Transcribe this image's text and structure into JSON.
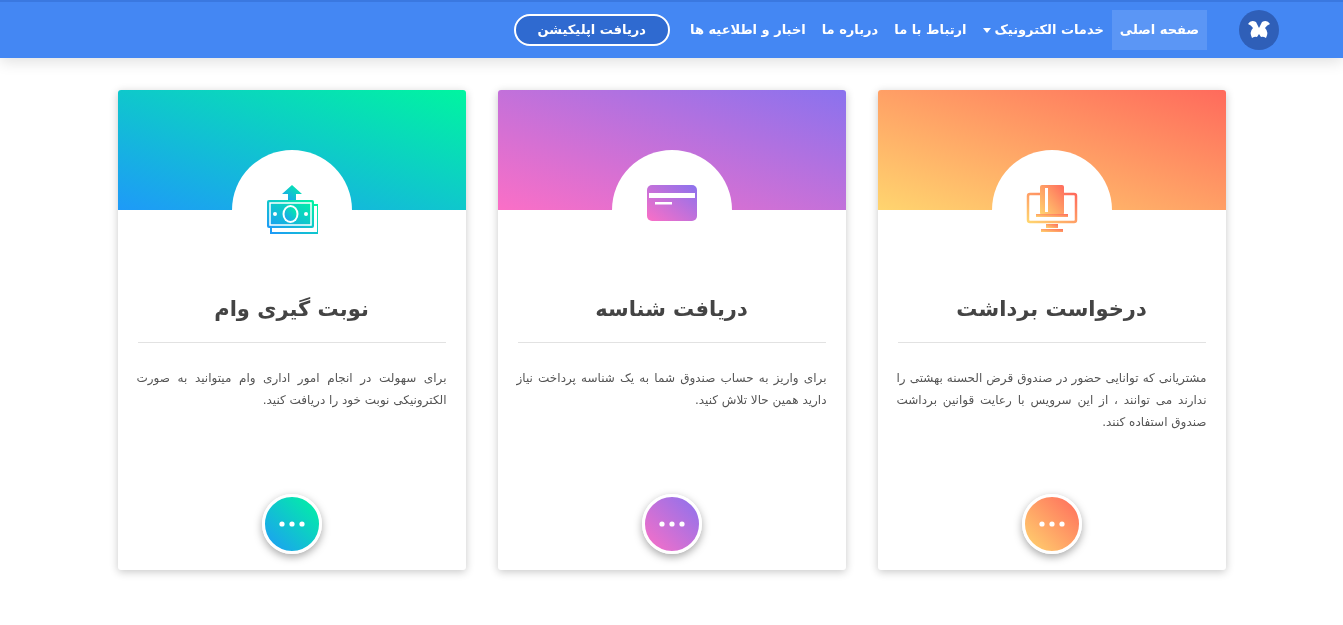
{
  "navbar": {
    "items": [
      {
        "label": "صفحه اصلی",
        "selected": true,
        "kind": "link"
      },
      {
        "label": "خدمات الکترونیک",
        "selected": false,
        "kind": "dropdown"
      },
      {
        "label": "ارتباط با ما",
        "selected": false,
        "kind": "link"
      },
      {
        "label": "درباره ما",
        "selected": false,
        "kind": "link"
      },
      {
        "label": "اخبار و اطلاعیه ها",
        "selected": false,
        "kind": "link"
      }
    ],
    "app_button": "دریافت اپلیکیشن"
  },
  "cards": [
    {
      "kind": "monitor",
      "color": "#ffd56f",
      "title": "درخواست برداشت",
      "description": "مشتریانی که توانایی حضور در صندوق قرض الحسنه بهشتی را ندارند می توانند ، از این سرویس با رعایت قوانین برداشت صندوق استفاده کنند."
    },
    {
      "kind": "card",
      "color": "#fb6fc6",
      "title": "دریافت شناسه",
      "description": "برای واریز به حساب صندوق شما به یک شناسه پرداخت نیاز دارید همین حالا تلاش کنید."
    },
    {
      "kind": "money",
      "color": "#1e9af8",
      "title": "نوبت گیری وام",
      "description": "برای سهولت در انجام امور اداری وام میتوانید به صورت الکترونیکی نوبت خود را دریافت کنید."
    }
  ]
}
